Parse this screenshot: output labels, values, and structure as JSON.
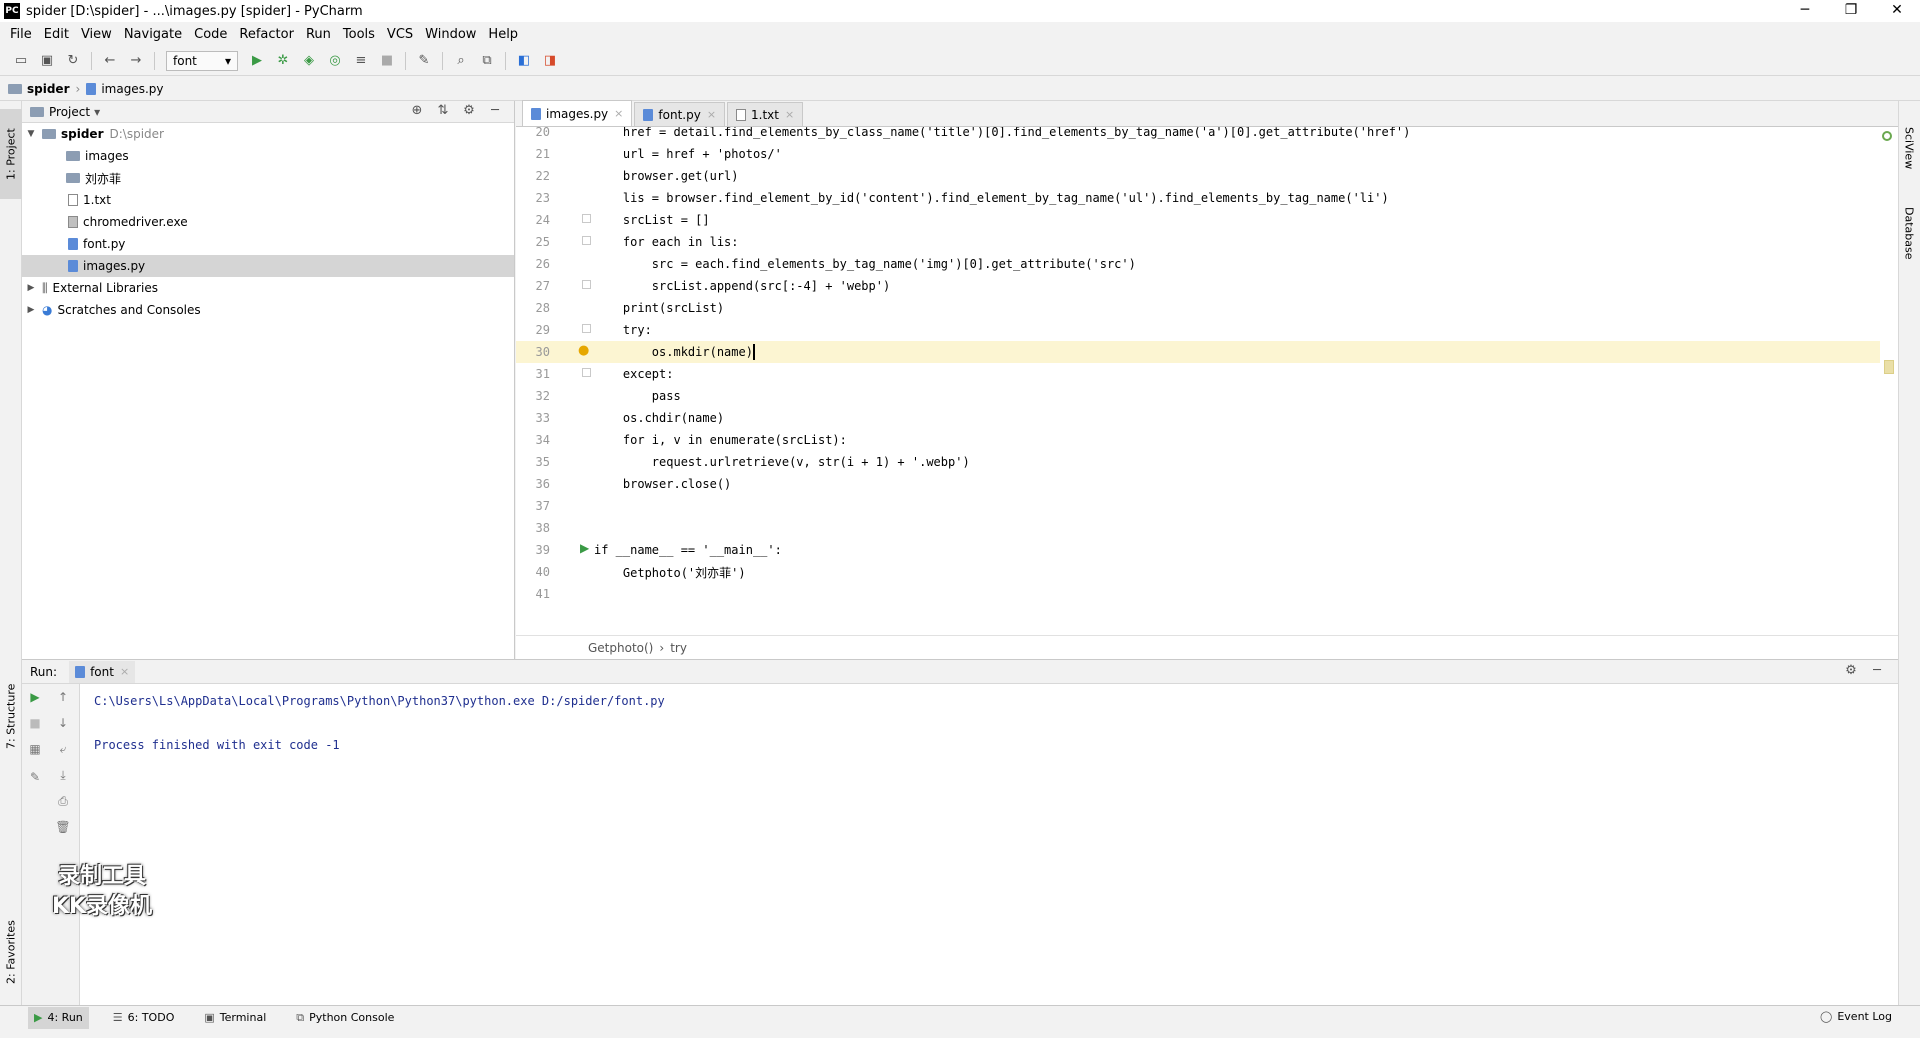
{
  "window": {
    "title": "spider [D:\\spider] - ...\\images.py [spider] - PyCharm",
    "min": "─",
    "max": "❐",
    "close": "✕"
  },
  "menu": [
    "File",
    "Edit",
    "View",
    "Navigate",
    "Code",
    "Refactor",
    "Run",
    "Tools",
    "VCS",
    "Window",
    "Help"
  ],
  "toolbar": {
    "run_config": "font"
  },
  "breadcrumb": {
    "project": "spider",
    "file": "images.py"
  },
  "project_panel": {
    "title": "Project",
    "root": {
      "name": "spider",
      "path": "D:\\spider"
    },
    "items": [
      {
        "name": "images",
        "kind": "folder"
      },
      {
        "name": "刘亦菲",
        "kind": "folder"
      },
      {
        "name": "1.txt",
        "kind": "txt"
      },
      {
        "name": "chromedriver.exe",
        "kind": "exe"
      },
      {
        "name": "font.py",
        "kind": "py"
      },
      {
        "name": "images.py",
        "kind": "py",
        "selected": true
      }
    ],
    "external": "External Libraries",
    "scratches": "Scratches and Consoles"
  },
  "editor": {
    "tabs": [
      {
        "label": "images.py",
        "active": true
      },
      {
        "label": "font.py",
        "active": false
      },
      {
        "label": "1.txt",
        "active": false
      }
    ],
    "lines": [
      {
        "n": "20",
        "code": "    href = detail.find_elements_by_class_name('title')[0].find_elements_by_tag_name('a')[0].get_attribute('href')"
      },
      {
        "n": "21",
        "code": "    url = href + 'photos/'"
      },
      {
        "n": "22",
        "code": "    browser.get(url)"
      },
      {
        "n": "23",
        "code": "    lis = browser.find_element_by_id('content').find_element_by_tag_name('ul').find_elements_by_tag_name('li')"
      },
      {
        "n": "24",
        "code": "    srcList = []"
      },
      {
        "n": "25",
        "code": "    for each in lis:"
      },
      {
        "n": "26",
        "code": "        src = each.find_elements_by_tag_name('img')[0].get_attribute('src')"
      },
      {
        "n": "27",
        "code": "        srcList.append(src[:-4] + 'webp')"
      },
      {
        "n": "28",
        "code": "    print(srcList)"
      },
      {
        "n": "29",
        "code": "    try:"
      },
      {
        "n": "30",
        "code": "        os.mkdir(name)"
      },
      {
        "n": "31",
        "code": "    except:"
      },
      {
        "n": "32",
        "code": "        pass"
      },
      {
        "n": "33",
        "code": "    os.chdir(name)"
      },
      {
        "n": "34",
        "code": "    for i, v in enumerate(srcList):"
      },
      {
        "n": "35",
        "code": "        request.urlretrieve(v, str(i + 1) + '.webp')"
      },
      {
        "n": "36",
        "code": "    browser.close()"
      },
      {
        "n": "37",
        "code": ""
      },
      {
        "n": "38",
        "code": ""
      },
      {
        "n": "39",
        "code": "if __name__ == '__main__':"
      },
      {
        "n": "40",
        "code": "    Getphoto('刘亦菲')"
      },
      {
        "n": "41",
        "code": ""
      }
    ],
    "crumb_func": "Getphoto()",
    "crumb_sep": "›",
    "crumb_block": "try"
  },
  "run_panel": {
    "label": "Run:",
    "tab": "font",
    "console": [
      "C:\\Users\\Ls\\AppData\\Local\\Programs\\Python\\Python37\\python.exe D:/spider/font.py",
      "",
      "Process finished with exit code -1"
    ]
  },
  "watermark": {
    "line1": "录制工具",
    "line2": "KK录像机"
  },
  "side_tabs": {
    "project": "1: Project",
    "structure": "7: Structure",
    "favorites": "2: Favorites",
    "sciview": "SciView",
    "database": "Database"
  },
  "bottom_bar": {
    "run": "4: Run",
    "todo": "6: TODO",
    "terminal": "Terminal",
    "python_console": "Python Console",
    "event_log": "Event Log"
  }
}
